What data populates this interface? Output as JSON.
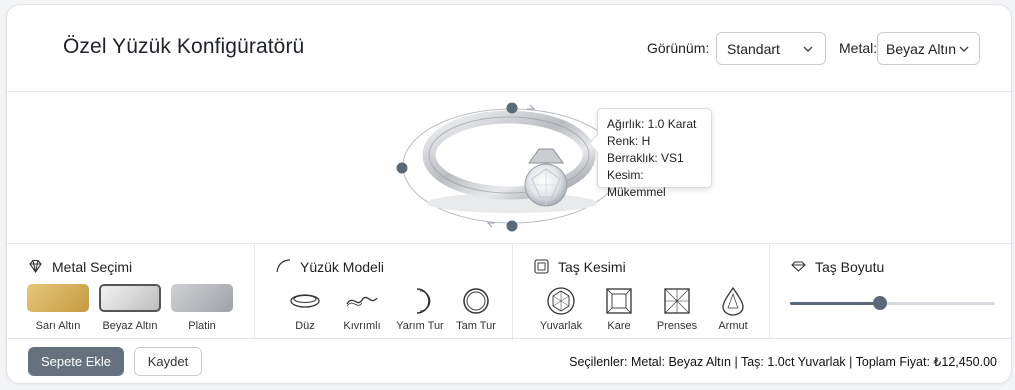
{
  "header": {
    "title": "Özel Yüzük Konfigüratörü",
    "view_label": "Görünüm:",
    "view_value": "Standart",
    "metal_label": "Metal:",
    "metal_value": "Beyaz Altın"
  },
  "tooltip": {
    "weight": "Ağırlık: 1.0 Karat",
    "color": "Renk: H",
    "clarity": "Berraklık: VS1",
    "cut": "Kesim: Mükemmel"
  },
  "metal_section": {
    "title": "Metal Seçimi",
    "options": [
      {
        "label": "Sarı Altın",
        "color": "#d7b25c"
      },
      {
        "label": "Beyaz Altın",
        "color": "#d9d9d9"
      },
      {
        "label": "Platin",
        "color": "#b4b6ba"
      }
    ],
    "selected": "Beyaz Altın"
  },
  "model_section": {
    "title": "Yüzük Modeli",
    "options": [
      {
        "label": "Düz",
        "icon": "flat-band-icon"
      },
      {
        "label": "Kıvrımlı",
        "icon": "twisted-band-icon"
      },
      {
        "label": "Yarım Tur",
        "icon": "half-eternity-icon"
      },
      {
        "label": "Tam Tur",
        "icon": "full-eternity-icon"
      }
    ]
  },
  "cut_section": {
    "title": "Taş Kesimi",
    "options": [
      {
        "label": "Yuvarlak",
        "icon": "round-cut-icon"
      },
      {
        "label": "Kare",
        "icon": "square-cut-icon"
      },
      {
        "label": "Prenses",
        "icon": "princess-cut-icon"
      },
      {
        "label": "Armut",
        "icon": "pear-cut-icon"
      }
    ]
  },
  "size_section": {
    "title": "Taş Boyutu",
    "slider_fraction": 0.44
  },
  "footer": {
    "add_to_cart": "Sepete Ekle",
    "save": "Kaydet",
    "summary": "Seçilenler:  Metal: Beyaz Altın | Taş: 1.0ct Yuvarlak | Toplam Fiyat: ₺12,450.00"
  }
}
